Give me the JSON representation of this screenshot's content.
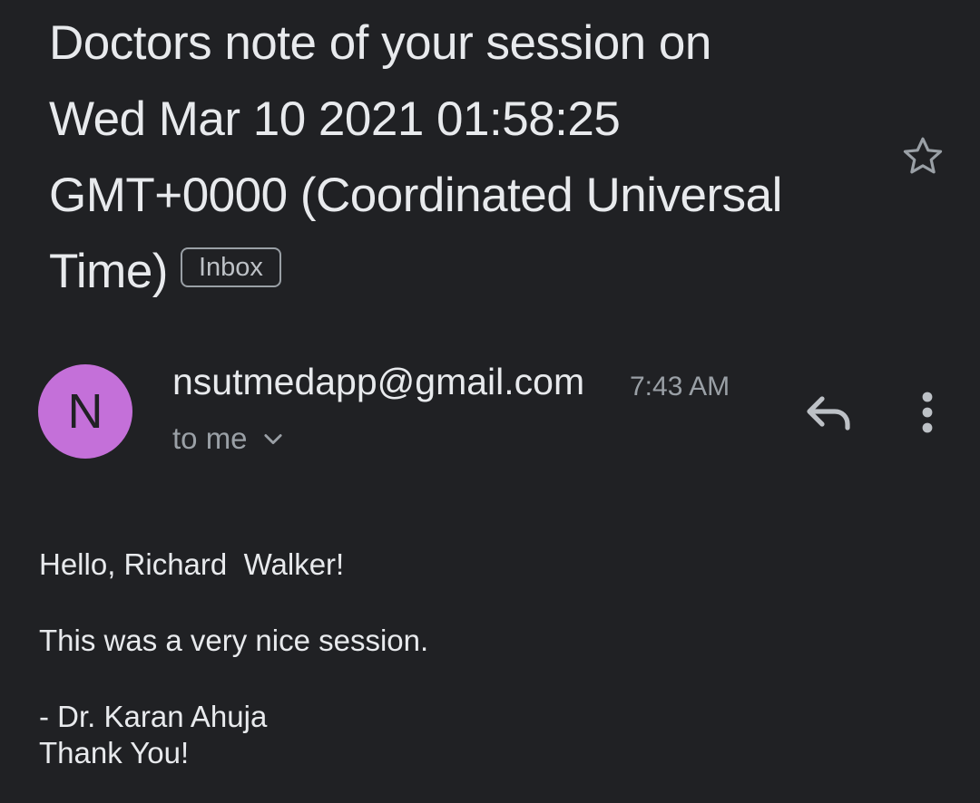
{
  "email": {
    "subject": "Doctors note of your session on Wed Mar 10 2021 01:58:25 GMT+0000 (Coordinated Universal Time)",
    "label": "Inbox",
    "star_icon": "star-outline-icon",
    "sender": {
      "avatar_initial": "N",
      "avatar_color": "#c470d9",
      "email": "nsutmedapp@gmail.com",
      "time": "7:43 AM",
      "recipient": "to me"
    },
    "actions": {
      "reply_icon": "reply-icon",
      "more_icon": "more-vert-icon",
      "expand_icon": "chevron-down-icon"
    },
    "body": {
      "greeting": "Hello, Richard  Walker!",
      "message": "This was a very nice session.",
      "signature": "- Dr. Karan Ahuja",
      "closing": "Thank You!"
    }
  },
  "colors": {
    "background": "#202124",
    "text_primary": "#e8eaed",
    "text_secondary": "#9aa0a6"
  }
}
